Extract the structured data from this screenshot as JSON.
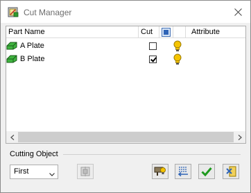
{
  "window": {
    "title": "Cut Manager"
  },
  "columns": {
    "part_name": "Part Name",
    "cut": "Cut",
    "attribute": "Attribute"
  },
  "rows": [
    {
      "label": "A Plate",
      "cut": false
    },
    {
      "label": "B Plate",
      "cut": true
    }
  ],
  "cutting_object": {
    "label": "Cutting Object",
    "selected": "First"
  },
  "colors": {
    "part_icon": "#2f9a2f",
    "bulb": "#f5c400",
    "ok_check": "#1f9a1f",
    "accent_blue": "#2f64b6"
  },
  "icons": {
    "app": "cut-manager-app-icon",
    "close": "close-icon",
    "part": "green-part-icon",
    "attribute": "lightbulb-icon",
    "pick": "pick-icon",
    "attribute_button": "attribute-edit-icon",
    "swap": "swap-list-icon",
    "ok": "checkmark-icon",
    "cancel": "cancel-icon"
  }
}
